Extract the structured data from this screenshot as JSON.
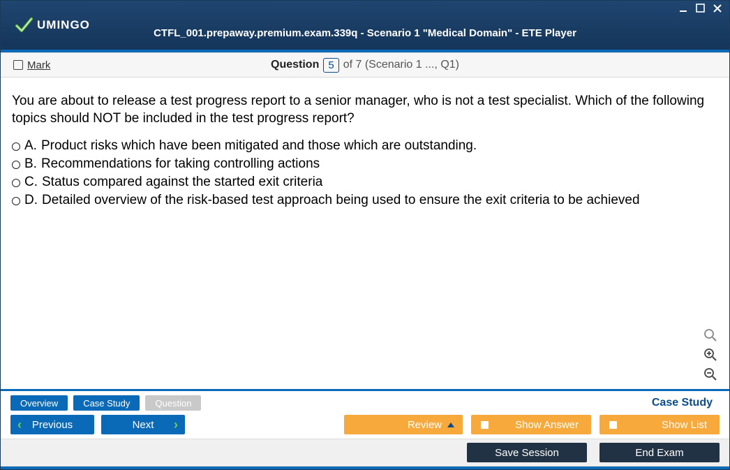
{
  "window": {
    "title": "CTFL_001.prepaway.premium.exam.339q - Scenario 1 \"Medical Domain\" - ETE Player",
    "brand": "UMINGO"
  },
  "header": {
    "mark_label": "Mark",
    "question_word": "Question",
    "question_number": "5",
    "question_suffix": "of 7 (Scenario 1 ..., Q1)"
  },
  "question": {
    "text": "You are about to release a test progress report to a senior manager, who is not a test specialist. Which of the following topics should NOT be included in the test progress report?",
    "options": [
      {
        "letter": "A.",
        "text": "Product risks which have been mitigated and those which are outstanding."
      },
      {
        "letter": "B.",
        "text": "Recommendations for taking controlling actions"
      },
      {
        "letter": "C.",
        "text": "Status compared against the started exit criteria"
      },
      {
        "letter": "D.",
        "text": "Detailed overview of the risk-based test approach being used to ensure the exit criteria to be achieved"
      }
    ]
  },
  "footer": {
    "tabs": {
      "overview": "Overview",
      "case_study": "Case Study",
      "question": "Question"
    },
    "case_study_label": "Case Study",
    "nav": {
      "previous": "Previous",
      "next": "Next"
    },
    "review": "Review",
    "show_answer": "Show Answer",
    "show_list": "Show List",
    "save_session": "Save Session",
    "end_exam": "End Exam"
  }
}
